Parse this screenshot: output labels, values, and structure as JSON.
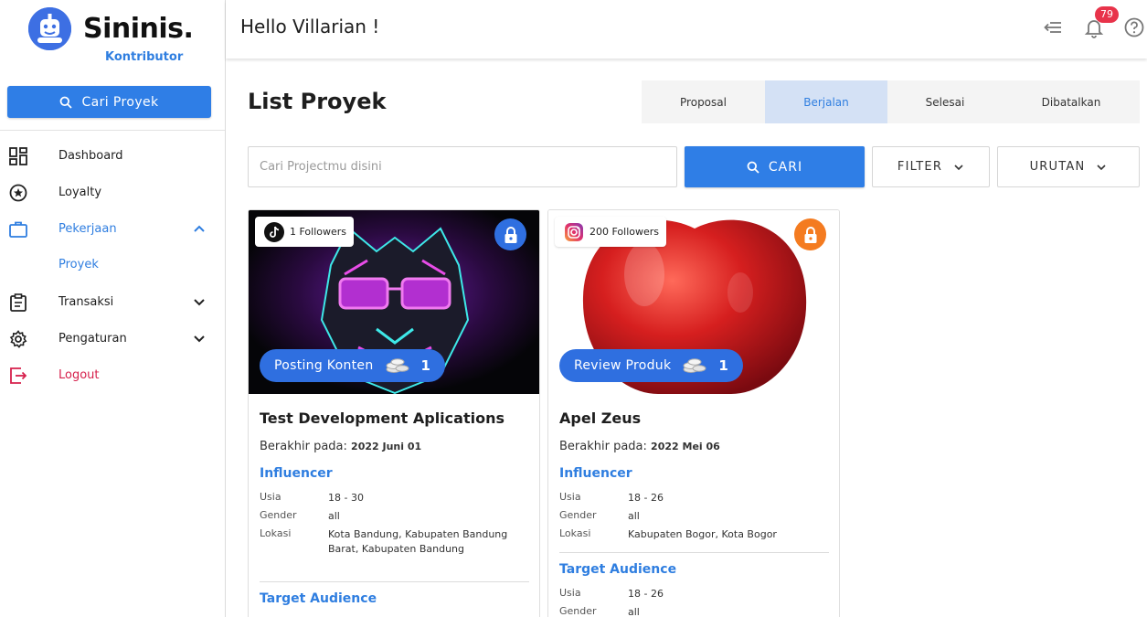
{
  "brand": {
    "name": "Sininis.",
    "subtitle": "Kontributor",
    "primary_color": "#2f7ee6"
  },
  "sidebar": {
    "search_label": "Cari Proyek",
    "items": [
      {
        "label": "Dashboard",
        "icon": "dashboard-icon"
      },
      {
        "label": "Loyalty",
        "icon": "star-circle-icon"
      },
      {
        "label": "Pekerjaan",
        "icon": "briefcase-icon",
        "expanded": true
      },
      {
        "label": "Transaksi",
        "icon": "clipboard-icon"
      },
      {
        "label": "Pengaturan",
        "icon": "gear-icon"
      },
      {
        "label": "Logout",
        "icon": "logout-icon"
      }
    ],
    "sub_item": "Proyek"
  },
  "header": {
    "greeting": "Hello Villarian !",
    "notification_count": "79"
  },
  "main": {
    "title": "List Proyek",
    "tabs": [
      {
        "label": "Proposal",
        "active": false
      },
      {
        "label": "Berjalan",
        "active": true
      },
      {
        "label": "Selesai",
        "active": false
      },
      {
        "label": "Dibatalkan",
        "active": false
      }
    ],
    "search_placeholder": "Cari Projectmu disini",
    "search_button": "CARI",
    "filter_label": "FILTER",
    "sort_label": "URUTAN"
  },
  "cards": [
    {
      "followers": "1 Followers",
      "platform_icon": "tiktok-icon",
      "lock_color": "#2f6fe0",
      "category": "Posting Konten",
      "coin_count": "1",
      "title": "Test Development Aplications",
      "ends_label": "Berakhir pada:",
      "ends_date": "2022 Juni 01",
      "influencer_heading": "Influencer",
      "age_label": "Usia",
      "age_value": "18 - 30",
      "gender_label": "Gender",
      "gender_value": "all",
      "location_label": "Lokasi",
      "location_value": "Kota Bandung, Kabupaten Bandung Barat, Kabupaten Bandung",
      "target_heading": "Target Audience"
    },
    {
      "followers": "200 Followers",
      "platform_icon": "instagram-icon",
      "lock_color": "#f47b20",
      "category": "Review Produk",
      "coin_count": "1",
      "title": "Apel Zeus",
      "ends_label": "Berakhir pada:",
      "ends_date": "2022 Mei 06",
      "influencer_heading": "Influencer",
      "age_label": "Usia",
      "age_value": "18 - 26",
      "gender_label": "Gender",
      "gender_value": "all",
      "location_label": "Lokasi",
      "location_value": "Kabupaten Bogor, Kota Bogor",
      "target_heading": "Target Audience",
      "target_age_label": "Usia",
      "target_age_value": "18 - 26",
      "target_gender_label": "Gender",
      "target_gender_value": "all"
    }
  ]
}
